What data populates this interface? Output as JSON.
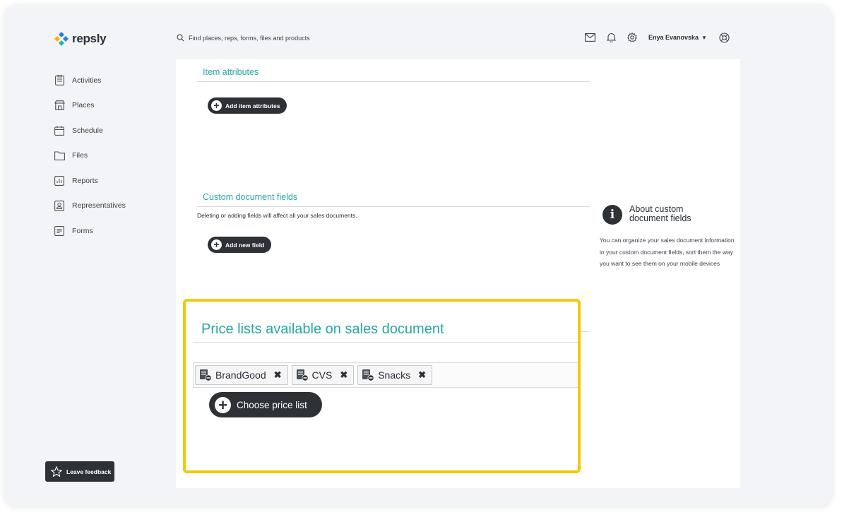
{
  "app": {
    "logo_text": "repsly"
  },
  "search": {
    "placeholder": "Find places, reps, forms, files and products"
  },
  "header": {
    "user_name": "Enya Evanovska"
  },
  "sidebar": {
    "items": [
      {
        "label": "Activities",
        "icon": "clipboard-icon"
      },
      {
        "label": "Places",
        "icon": "store-icon"
      },
      {
        "label": "Schedule",
        "icon": "calendar-icon"
      },
      {
        "label": "Files",
        "icon": "folder-icon"
      },
      {
        "label": "Reports",
        "icon": "chart-icon"
      },
      {
        "label": "Representatives",
        "icon": "person-badge-icon"
      },
      {
        "label": "Forms",
        "icon": "form-icon"
      }
    ],
    "feedback_label": "Leave feedback"
  },
  "item_attributes": {
    "title": "Item attributes",
    "add_button": "Add item attributes"
  },
  "custom_fields": {
    "title": "Custom document fields",
    "note": "Deleting or adding fields will affect all your sales documents.",
    "add_button": "Add new field"
  },
  "info": {
    "title": "About custom document fields",
    "text": "You can organize your sales document information in your custom document fields, sort them the way you want to see them on your mobile devices"
  },
  "price_lists": {
    "title": "Price lists available on sales document",
    "tags": [
      {
        "label": "BrandGood"
      },
      {
        "label": "CVS"
      },
      {
        "label": "Snacks"
      }
    ],
    "choose_button": "Choose price list"
  },
  "colors": {
    "accent_teal": "#27a6a4",
    "highlight_yellow": "#f5c800",
    "dark_button": "#2e3136",
    "logo_blue": "#2b7fd8",
    "logo_yellow": "#f7b500",
    "logo_teal": "#27b3a8"
  }
}
